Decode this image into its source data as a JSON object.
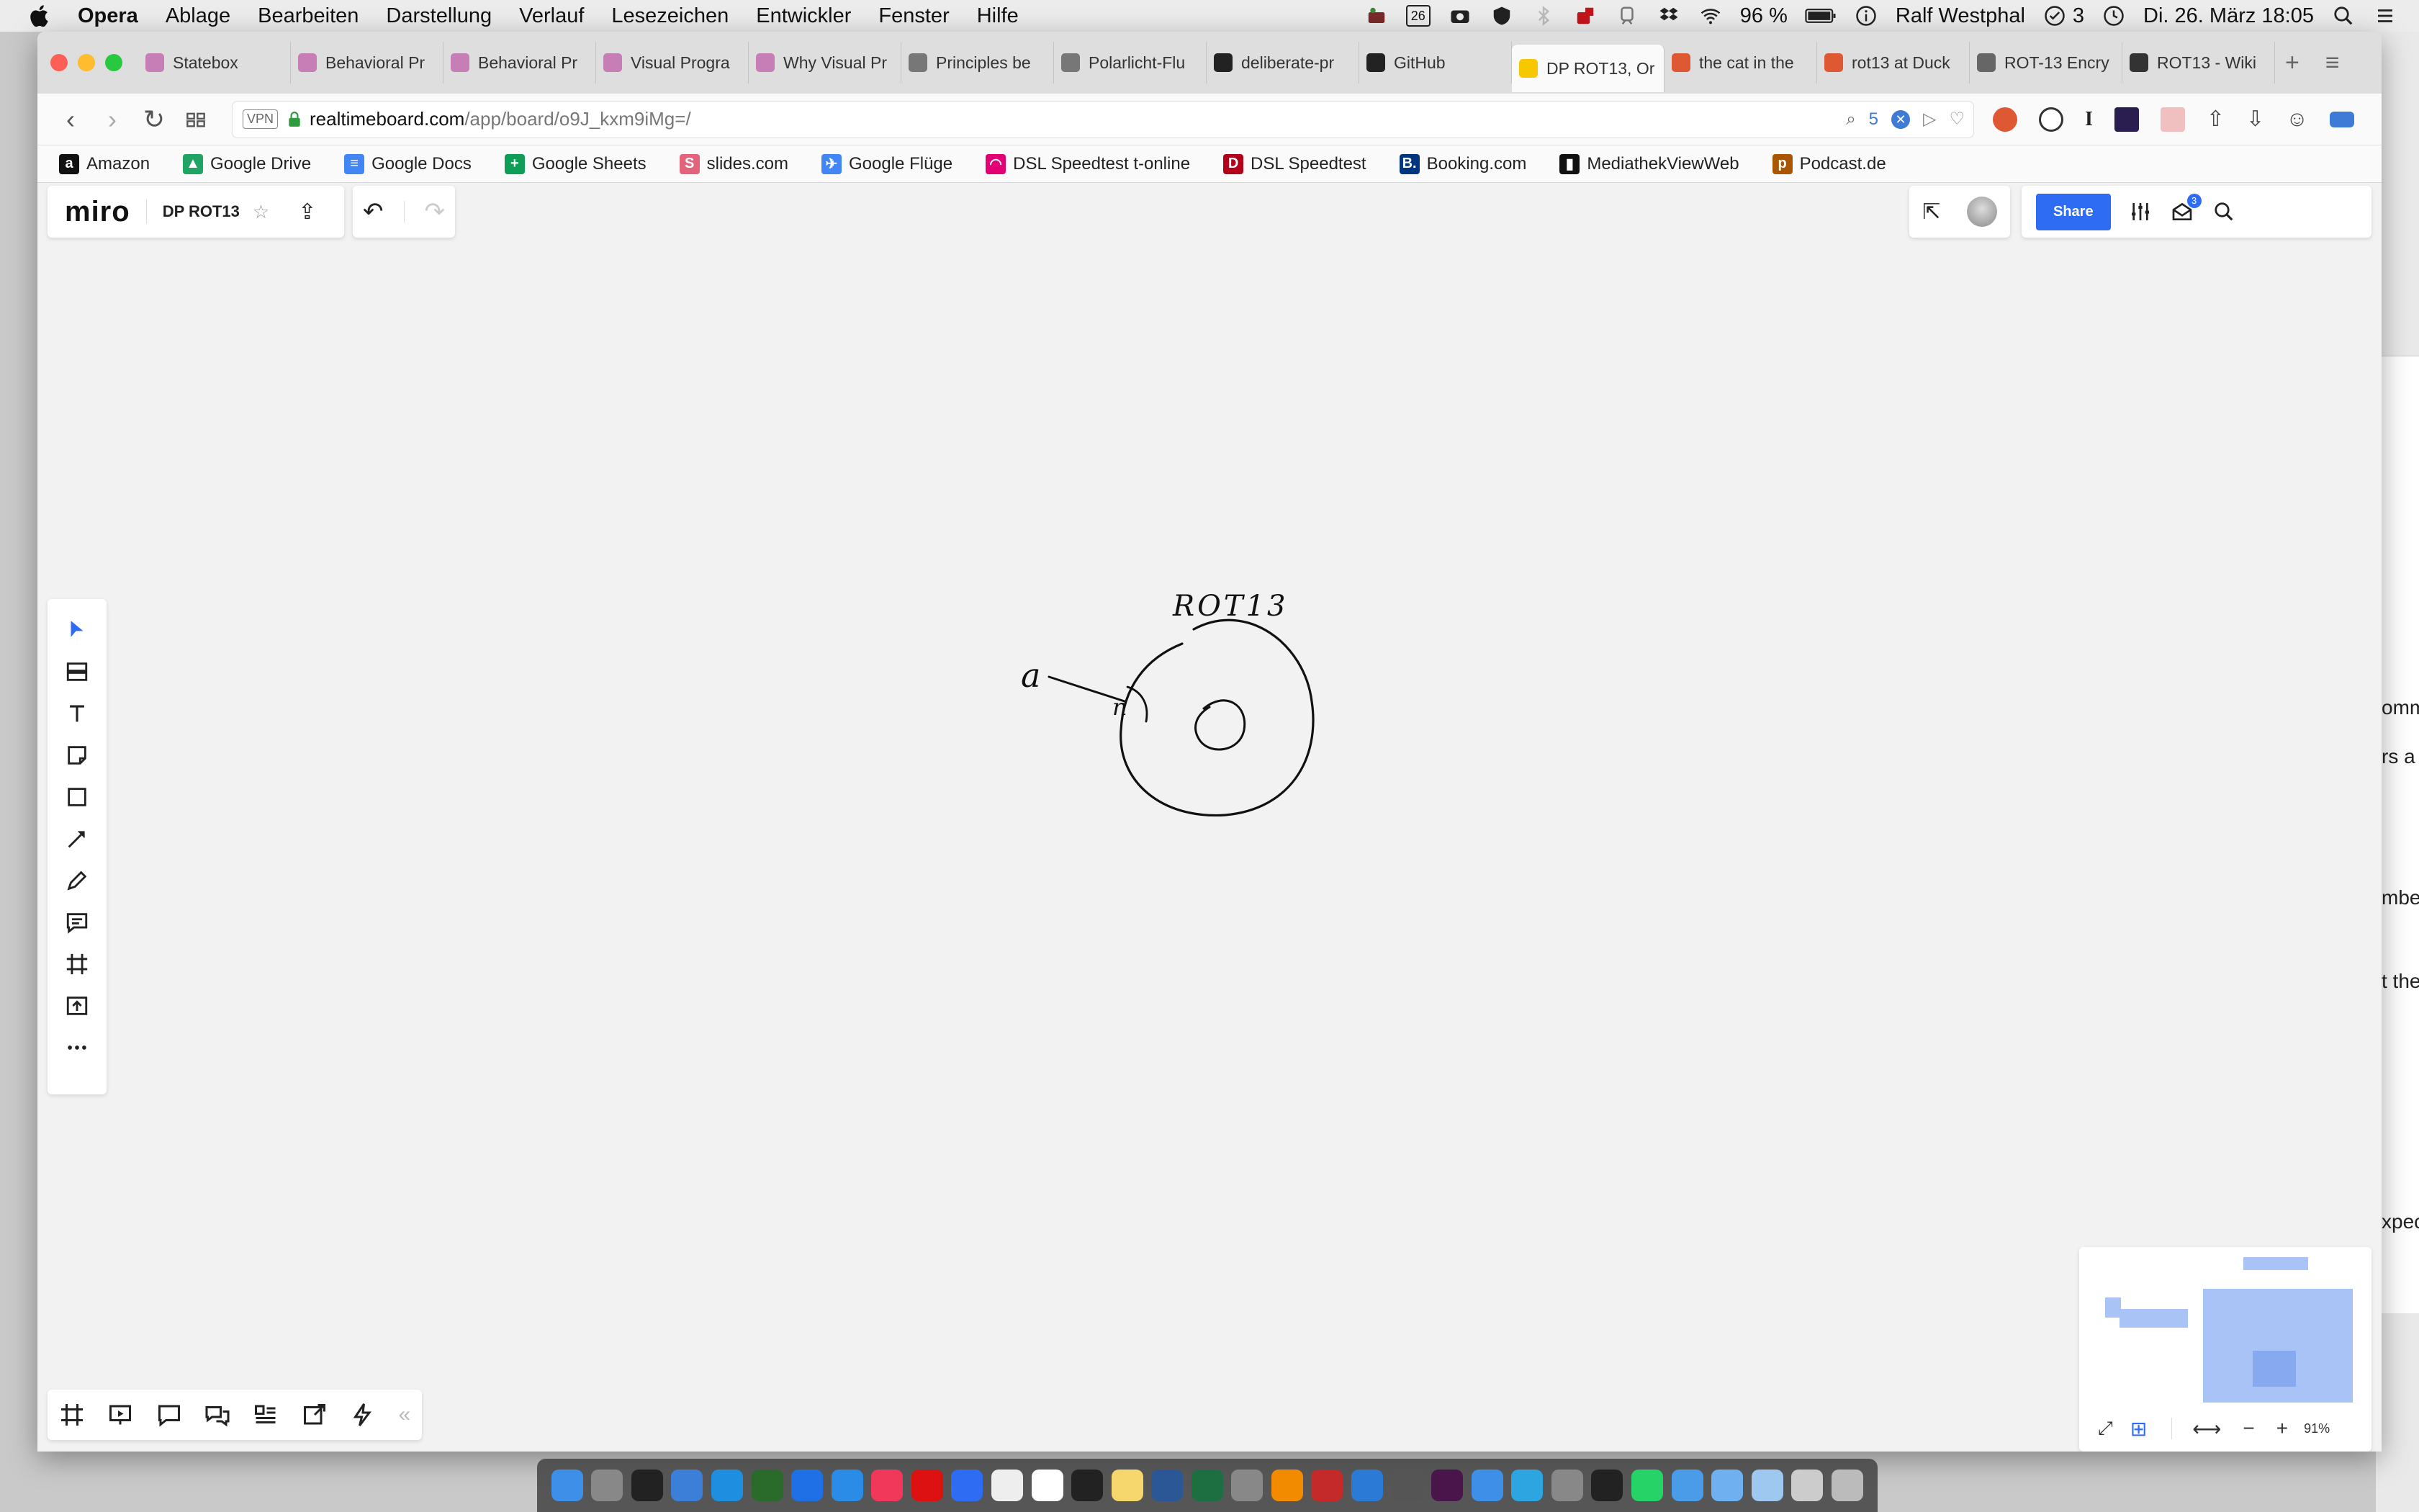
{
  "menubar": {
    "app": "Opera",
    "items": [
      "Ablage",
      "Bearbeiten",
      "Darstellung",
      "Verlauf",
      "Lesezeichen",
      "Entwickler",
      "Fenster",
      "Hilfe"
    ],
    "calendar_day": "26",
    "battery": "96 %",
    "user": "Ralf Westphal",
    "tasks_count": "3",
    "datetime": "Di. 26. März  18:05"
  },
  "tabs": [
    {
      "label": "Statebox",
      "color": "#c77db5"
    },
    {
      "label": "Behavioral Pr",
      "color": "#c77db5"
    },
    {
      "label": "Behavioral Pr",
      "color": "#c77db5"
    },
    {
      "label": "Visual Progra",
      "color": "#c77db5"
    },
    {
      "label": "Why Visual Pr",
      "color": "#c77db5"
    },
    {
      "label": "Principles be",
      "color": "#777777"
    },
    {
      "label": "Polarlicht-Flu",
      "color": "#777777"
    },
    {
      "label": "deliberate-pr",
      "color": "#222222"
    },
    {
      "label": "GitHub",
      "color": "#222222"
    },
    {
      "label": "DP ROT13, Or",
      "color": "#f7c800",
      "active": true
    },
    {
      "label": "the cat in the",
      "color": "#de5833"
    },
    {
      "label": "rot13 at Duck",
      "color": "#de5833"
    },
    {
      "label": "ROT-13 Encry",
      "color": "#666666"
    },
    {
      "label": "ROT13 - Wiki",
      "color": "#333333"
    }
  ],
  "address": {
    "vpn": "VPN",
    "host": "realtimeboard.com",
    "path": "/app/board/o9J_kxm9iMg=/",
    "search_count": "5"
  },
  "bookmarks": [
    {
      "label": "Amazon",
      "icon": "a",
      "color": "#111111"
    },
    {
      "label": "Google Drive",
      "icon": "▲",
      "color": "#1fa463"
    },
    {
      "label": "Google Docs",
      "icon": "≡",
      "color": "#4285f4"
    },
    {
      "label": "Google Sheets",
      "icon": "+",
      "color": "#0f9d58"
    },
    {
      "label": "slides.com",
      "icon": "S",
      "color": "#e4637c"
    },
    {
      "label": "Google Flüge",
      "icon": "✈",
      "color": "#4285f4"
    },
    {
      "label": "DSL Speedtest t-online",
      "icon": "◠",
      "color": "#e20074"
    },
    {
      "label": "DSL Speedtest",
      "icon": "D",
      "color": "#b3001b"
    },
    {
      "label": "Booking.com",
      "icon": "B.",
      "color": "#003580"
    },
    {
      "label": "MediathekViewWeb",
      "icon": "▮",
      "color": "#111111"
    },
    {
      "label": "Podcast.de",
      "icon": "p",
      "color": "#aa5500"
    }
  ],
  "board": {
    "logo": "miro",
    "name": "DP ROT13",
    "share_label": "Share",
    "notifications": "3",
    "zoom": "91%"
  },
  "drawing": {
    "label": "ROT13",
    "input_symbol": "a",
    "output_symbol": "n"
  },
  "desktop_fragments": [
    "omm",
    "rs a",
    "mbe",
    "t the",
    "xpec"
  ],
  "dock_apps": [
    "Finder",
    "Launchpad",
    "Activity",
    "Safari",
    "Scrivener",
    "Grapher",
    "1Password",
    "App Store",
    "Music",
    "Opera",
    "Pointer",
    "Reminders",
    "Calendar",
    "Notion",
    "Notes",
    "Word",
    "Excel",
    "Preview",
    "Sublime",
    "Rider",
    "VS Code",
    "GitHub",
    "Slack",
    "Mail",
    "Telegram",
    "Tool",
    "Terminal",
    "WhatsApp",
    "Tool2",
    "Folder",
    "Downloads",
    "Docs",
    "Trash"
  ]
}
